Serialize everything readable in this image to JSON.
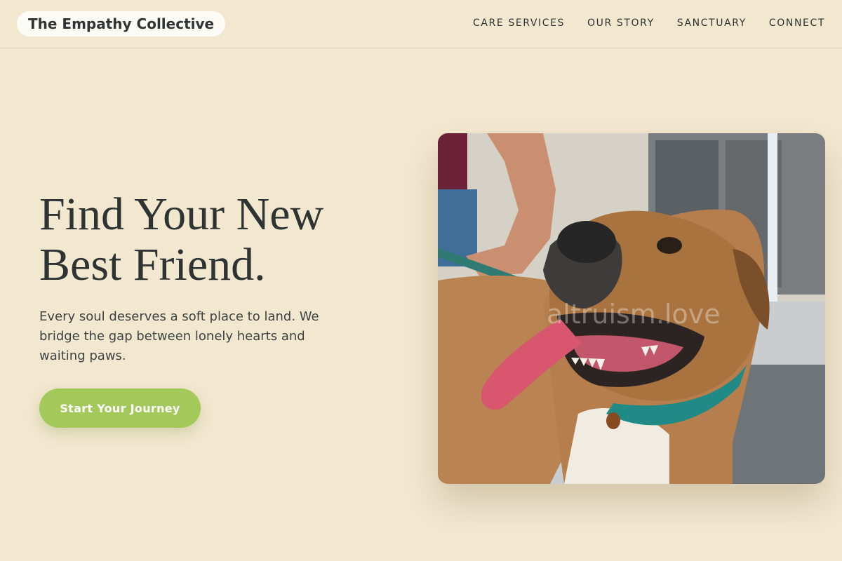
{
  "brand": {
    "name": "The Empathy Collective"
  },
  "nav": {
    "items": [
      {
        "label": "CARE SERVICES"
      },
      {
        "label": "OUR STORY"
      },
      {
        "label": "SANCTUARY"
      },
      {
        "label": "CONNECT"
      }
    ]
  },
  "hero": {
    "title_line1": "Find Your New",
    "title_line2": "Best Friend.",
    "description": "Every soul deserves a soft place to land. We bridge the gap between lonely hearts and waiting paws.",
    "cta_label": "Start Your Journey"
  },
  "photo": {
    "subject": "happy-dog-photo",
    "watermark": "altruism.love"
  },
  "colors": {
    "background": "#f2e7cf",
    "text": "#2e3433",
    "accent": "#a3c95a",
    "logo_pill": "#fdfbf6"
  }
}
